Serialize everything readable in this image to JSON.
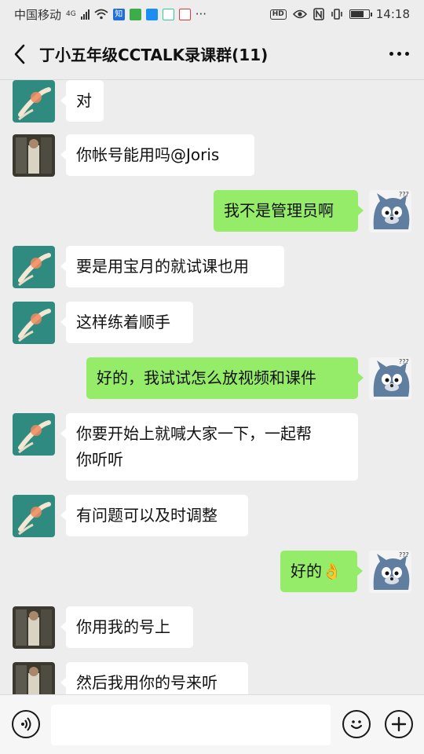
{
  "status_bar": {
    "carrier": "中国移动",
    "network": "4G",
    "time": "14:18",
    "hd": "HD",
    "battery_level": 0.75,
    "app_icons": [
      "zhihu-icon",
      "wechat-mini-icon",
      "alipay-icon",
      "video-icon",
      "youku-icon"
    ],
    "app_icon_labels": [
      "知"
    ],
    "more_indicator": "···"
  },
  "header": {
    "title": "丁小五年级CCTALK录课群(11)"
  },
  "messages": [
    {
      "side": "in",
      "avatar": "hand",
      "text": "对"
    },
    {
      "side": "in",
      "avatar": "photo",
      "text": "你帐号能用吗@Joris"
    },
    {
      "side": "out",
      "avatar": "cat",
      "text": "我不是管理员啊"
    },
    {
      "side": "in",
      "avatar": "hand",
      "text": "要是用宝月的就试课也用"
    },
    {
      "side": "in",
      "avatar": "hand",
      "text": "这样练着顺手"
    },
    {
      "side": "out",
      "avatar": "cat",
      "text": "好的，我试试怎么放视频和课件"
    },
    {
      "side": "in",
      "avatar": "hand",
      "text": "你要开始上就喊大家一下，一起帮\n你听听"
    },
    {
      "side": "in",
      "avatar": "hand",
      "text": "有问题可以及时调整"
    },
    {
      "side": "out",
      "avatar": "cat",
      "text": "好的👌"
    },
    {
      "side": "in",
      "avatar": "photo",
      "text": "你用我的号上"
    },
    {
      "side": "in",
      "avatar": "photo",
      "text": "然后我用你的号来听"
    }
  ],
  "input_bar": {
    "placeholder": "",
    "voice_icon": "voice-icon",
    "emoji_icon": "emoji-icon",
    "plus_icon": "plus-icon"
  },
  "colors": {
    "background": "#ededed",
    "incoming_bubble": "#ffffff",
    "outgoing_bubble": "#95ec69"
  }
}
